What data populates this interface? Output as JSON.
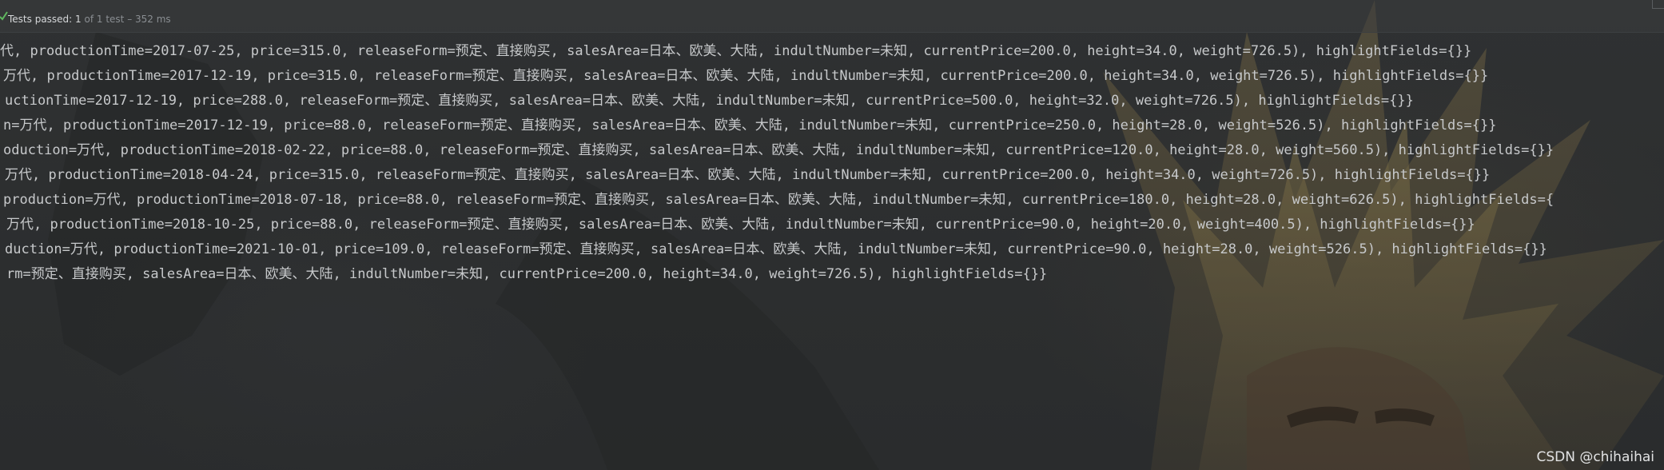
{
  "status_bar": {
    "passed_label": "Tests passed:",
    "passed_count": "1",
    "detail": "of 1 test – 352 ms"
  },
  "console": {
    "lines": [
      "代, productionTime=2017-07-25, price=315.0, releaseForm=预定、直接购买, salesArea=日本、欧美、大陆, indultNumber=未知, currentPrice=200.0, height=34.0, weight=726.5), highlightFields={}}",
      "万代, productionTime=2017-12-19, price=315.0, releaseForm=预定、直接购买, salesArea=日本、欧美、大陆, indultNumber=未知, currentPrice=200.0, height=34.0, weight=726.5), highlightFields={}}",
      "uctionTime=2017-12-19, price=288.0, releaseForm=预定、直接购买, salesArea=日本、欧美、大陆, indultNumber=未知, currentPrice=500.0, height=32.0, weight=726.5), highlightFields={}}",
      "n=万代, productionTime=2017-12-19, price=88.0, releaseForm=预定、直接购买, salesArea=日本、欧美、大陆, indultNumber=未知, currentPrice=250.0, height=28.0, weight=526.5), highlightFields={}}",
      "oduction=万代, productionTime=2018-02-22, price=88.0, releaseForm=预定、直接购买, salesArea=日本、欧美、大陆, indultNumber=未知, currentPrice=120.0, height=28.0, weight=560.5), highlightFields={}}",
      "万代, productionTime=2018-04-24, price=315.0, releaseForm=预定、直接购买, salesArea=日本、欧美、大陆, indultNumber=未知, currentPrice=200.0, height=34.0, weight=726.5), highlightFields={}}",
      "production=万代, productionTime=2018-07-18, price=88.0, releaseForm=预定、直接购买, salesArea=日本、欧美、大陆, indultNumber=未知, currentPrice=180.0, height=28.0, weight=626.5), highlightFields={",
      "万代, productionTime=2018-10-25, price=88.0, releaseForm=预定、直接购买, salesArea=日本、欧美、大陆, indultNumber=未知, currentPrice=90.0, height=20.0, weight=400.5), highlightFields={}}",
      "duction=万代, productionTime=2021-10-01, price=109.0, releaseForm=预定、直接购买, salesArea=日本、欧美、大陆, indultNumber=未知, currentPrice=90.0, height=28.0, weight=526.5), highlightFields={}}",
      "rm=预定、直接购买, salesArea=日本、欧美、大陆, indultNumber=未知, currentPrice=200.0, height=34.0, weight=726.5), highlightFields={}}"
    ]
  },
  "watermark": "CSDN @chihaihai",
  "colors": {
    "status_check": "#5fb85f",
    "console_text": "#c7c9cb",
    "background": "#2b2d2e"
  }
}
